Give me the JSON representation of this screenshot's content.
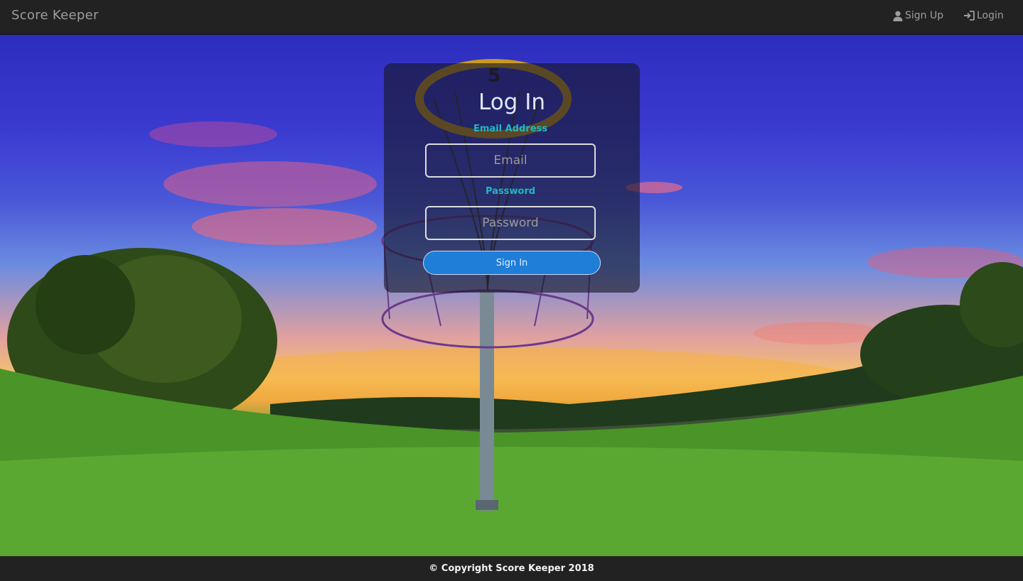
{
  "nav": {
    "brand": "Score Keeper",
    "links": [
      {
        "label": "Sign Up",
        "icon": "user-icon"
      },
      {
        "label": "Login",
        "icon": "login-icon"
      }
    ]
  },
  "background": {
    "icon": "disc-golf-basket-scene",
    "basket_number": "5"
  },
  "login": {
    "title": "Log In",
    "email_label": "Email Address",
    "email_placeholder": "Email",
    "password_label": "Password",
    "password_placeholder": "Password",
    "submit_label": "Sign In"
  },
  "footer": {
    "text": "© Copyright Score Keeper 2018"
  },
  "colors": {
    "navbar": "#222222",
    "label_accent": "#20b7c4",
    "button": "#1f7ed8"
  }
}
